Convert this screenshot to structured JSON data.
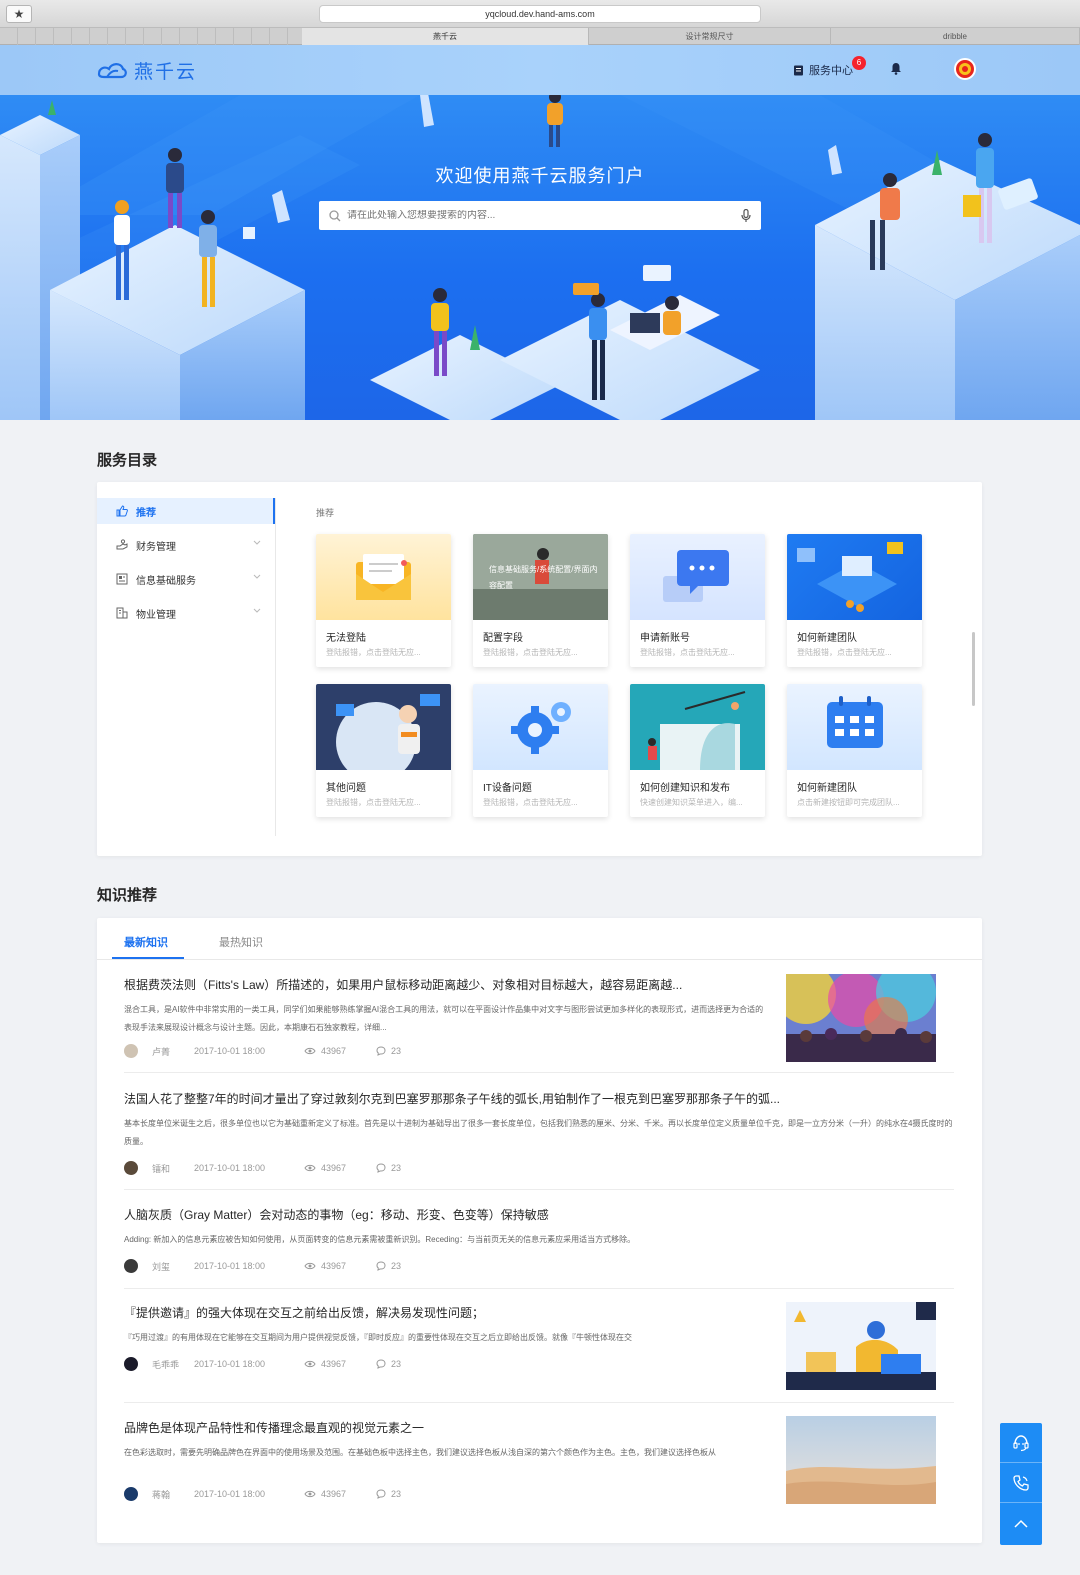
{
  "browser": {
    "url": "yqcloud.dev.hand-ams.com",
    "tabs": [
      "燕千云",
      "设计常规尺寸",
      "dribble"
    ]
  },
  "header": {
    "logo_text": "燕千云",
    "service_center": "服务中心",
    "badge_count": "6"
  },
  "hero": {
    "title": "欢迎使用燕千云服务门户",
    "search_placeholder": "请在此处输入您想要搜索的内容..."
  },
  "catalog": {
    "section_title": "服务目录",
    "grid_label": "推荐",
    "menu": [
      {
        "label": "推荐"
      },
      {
        "label": "财务管理"
      },
      {
        "label": "信息基础服务"
      },
      {
        "label": "物业管理"
      }
    ],
    "cards": [
      {
        "title": "无法登陆",
        "desc": "登陆报错，点击登陆无应..."
      },
      {
        "title": "配置字段",
        "desc": "登陆报错，点击登陆无应...",
        "overlay": "信息基础服务/系统配置/界面内容配置"
      },
      {
        "title": "申请新账号",
        "desc": "登陆报错，点击登陆无应..."
      },
      {
        "title": "如何新建团队",
        "desc": "登陆报错，点击登陆无应..."
      },
      {
        "title": "其他问题",
        "desc": "登陆报错，点击登陆无应..."
      },
      {
        "title": "IT设备问题",
        "desc": "登陆报错，点击登陆无应..."
      },
      {
        "title": "如何创建知识和发布",
        "desc": "快速创建知识菜单进入，编..."
      },
      {
        "title": "如何新建团队",
        "desc": "点击新建按钮即可完成团队..."
      }
    ]
  },
  "knowledge": {
    "section_title": "知识推荐",
    "tabs": [
      "最新知识",
      "最热知识"
    ],
    "articles": [
      {
        "title": "根据费茨法则（Fitts's Law）所描述的，如果用户鼠标移动距离越少、对象相对目标越大，越容易距离越...",
        "summary": "混合工具，是AI软件中非常实用的一类工具，同学们如果能够熟练掌握AI混合工具的用法，就可以在平面设计作品集中对文字与图形尝试更加多样化的表现形式，进而选择更为合适的表现手法来展现设计概念与设计主题。因此，本期康石石独家教程，详细...",
        "author": "卢菁",
        "time": "2017-10-01 18:00",
        "views": "43967",
        "comments": "23"
      },
      {
        "title": "法国人花了整整7年的时间才量出了穿过敦刻尔克到巴塞罗那那条子午线的弧长,用铂制作了一根克到巴塞罗那那条子午的弧...",
        "summary": "基本长度单位米诞生之后，很多单位也以它为基础重新定义了标准。首先是以十进制为基础导出了很多一套长度单位，包括我们熟悉的厘米、分米、千米。再以长度单位定义质量单位千克，即是一立方分米（一升）的纯水在4摄氏度时的质量。",
        "author": "镭和",
        "time": "2017-10-01 18:00",
        "views": "43967",
        "comments": "23"
      },
      {
        "title": "人脑灰质（Gray Matter）会对动态的事物（eg：移动、形变、色变等）保持敏感",
        "summary": "Adding: 新加入的信息元素应被告知如何使用，从页面转变的信息元素需被重新识别。Receding：与当前页无关的信息元素应采用适当方式移除。",
        "author": "刘玺",
        "time": "2017-10-01 18:00",
        "views": "43967",
        "comments": "23"
      },
      {
        "title": "『提供邀请』的强大体现在交互之前给出反馈，解决易发现性问题；",
        "summary": "『巧用过渡』的有用体现在它能够在交互期间为用户提供视觉反馈，『即时反应』的重要性体现在交互之后立即给出反馈。就像『牛顿性体现在交",
        "author": "毛乖乖",
        "time": "2017-10-01 18:00",
        "views": "43967",
        "comments": "23"
      },
      {
        "title": "品牌色是体现产品特性和传播理念最直观的视觉元素之一",
        "summary": "在色彩选取时，需要先明确品牌色在界面中的使用场景及范围。在基础色板中选择主色，我们建议选择色板从浅自深的第六个颜色作为主色。主色，我们建议选择色板从",
        "author": "蒋翰",
        "time": "2017-10-01 18:00",
        "views": "43967",
        "comments": "23"
      }
    ]
  },
  "colors": {
    "primary": "#1d72f0",
    "hero_bg": "#1c6ff0",
    "badge": "#f5222d"
  },
  "icons": [
    "star-icon",
    "logo-icon",
    "service-center-icon",
    "bell-icon",
    "search-icon",
    "microphone-icon",
    "thumbs-up-icon",
    "finance-icon",
    "info-service-icon",
    "building-icon",
    "chevron-down-icon",
    "eye-icon",
    "comment-icon",
    "customer-service-icon",
    "phone-icon",
    "chevron-up-icon"
  ]
}
